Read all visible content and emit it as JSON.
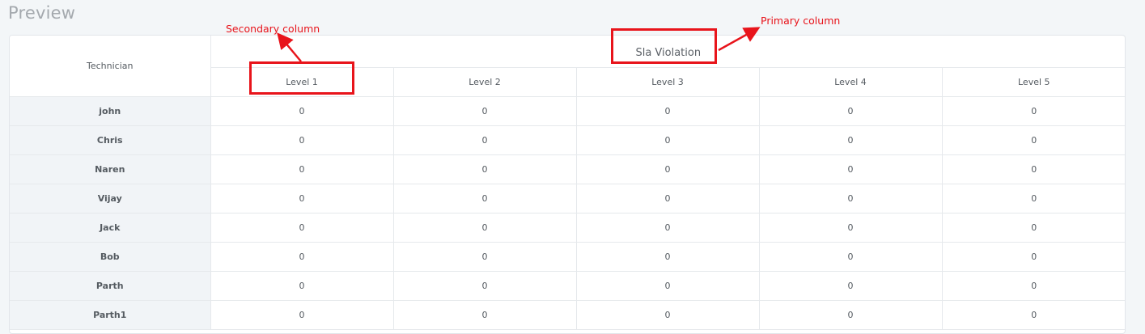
{
  "page": {
    "title": "Preview"
  },
  "table": {
    "technician_header": "Technician",
    "primary_header": "Sla Violation",
    "levels": [
      "Level 1",
      "Level 2",
      "Level 3",
      "Level 4",
      "Level 5"
    ],
    "rows": [
      {
        "name": "john",
        "values": [
          "0",
          "0",
          "0",
          "0",
          "0"
        ]
      },
      {
        "name": "Chris",
        "values": [
          "0",
          "0",
          "0",
          "0",
          "0"
        ]
      },
      {
        "name": "Naren",
        "values": [
          "0",
          "0",
          "0",
          "0",
          "0"
        ]
      },
      {
        "name": "Vijay",
        "values": [
          "0",
          "0",
          "0",
          "0",
          "0"
        ]
      },
      {
        "name": "Jack",
        "values": [
          "0",
          "0",
          "0",
          "0",
          "0"
        ]
      },
      {
        "name": "Bob",
        "values": [
          "0",
          "0",
          "0",
          "0",
          "0"
        ]
      },
      {
        "name": "Parth",
        "values": [
          "0",
          "0",
          "0",
          "0",
          "0"
        ]
      },
      {
        "name": "Parth1",
        "values": [
          "0",
          "0",
          "0",
          "0",
          "0"
        ]
      }
    ]
  },
  "annotations": {
    "secondary_label": "Secondary column",
    "primary_label": "Primary column",
    "color": "#e8141b"
  }
}
